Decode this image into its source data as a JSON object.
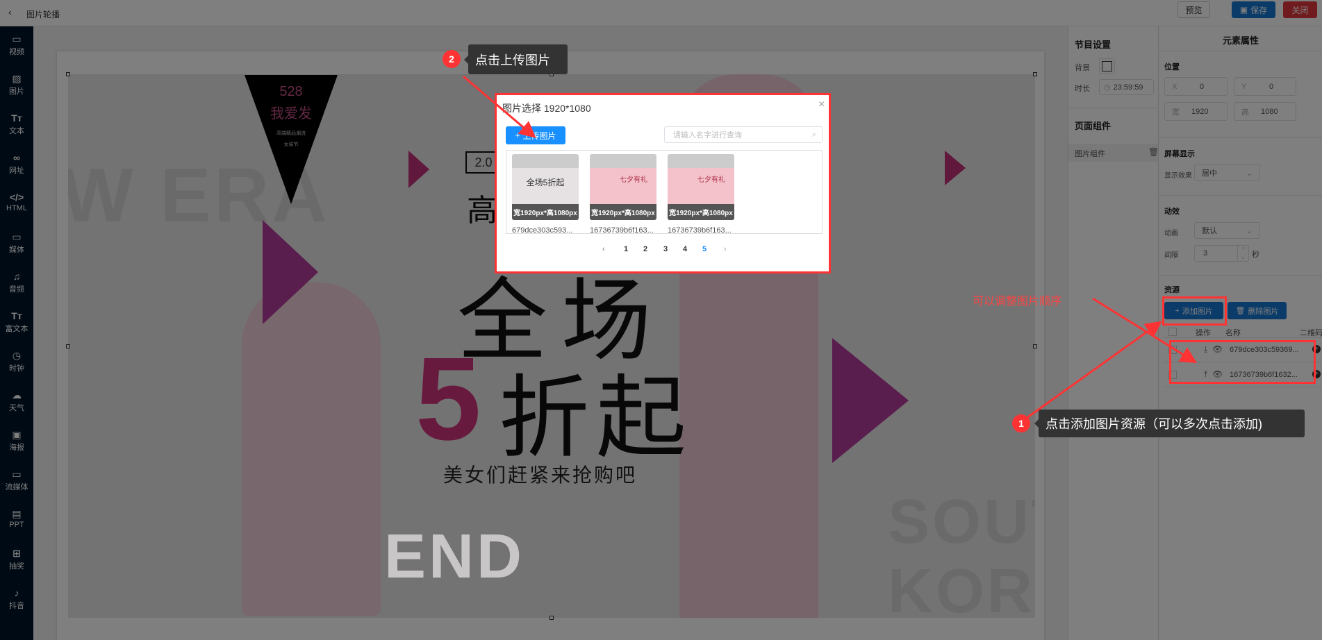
{
  "header": {
    "back_icon": "chevron-left-icon",
    "title": "图片轮播",
    "preview": "预览",
    "save": "保存",
    "close": "关闭",
    "colors": {
      "save": "#1677d2",
      "close": "#e0383e"
    }
  },
  "sidebar": {
    "items": [
      {
        "label": "视频",
        "icon": "video-icon",
        "glyph": "▭"
      },
      {
        "label": "图片",
        "icon": "image-icon",
        "glyph": "▨"
      },
      {
        "label": "文本",
        "icon": "text-icon",
        "glyph": "Tт"
      },
      {
        "label": "网址",
        "icon": "link-icon",
        "glyph": "∞"
      },
      {
        "label": "HTML",
        "icon": "code-icon",
        "glyph": "</>"
      },
      {
        "label": "媒体",
        "icon": "media-icon",
        "glyph": "▭"
      },
      {
        "label": "音频",
        "icon": "music-icon",
        "glyph": "♫"
      },
      {
        "label": "富文本",
        "icon": "rich-text-icon",
        "glyph": "Tт"
      },
      {
        "label": "时钟",
        "icon": "clock-icon",
        "glyph": "◷"
      },
      {
        "label": "天气",
        "icon": "cloud-icon",
        "glyph": "☁"
      },
      {
        "label": "海报",
        "icon": "poster-icon",
        "glyph": "▣"
      },
      {
        "label": "流媒体",
        "icon": "stream-icon",
        "glyph": "▭"
      },
      {
        "label": "PPT",
        "icon": "ppt-icon",
        "glyph": "▤"
      },
      {
        "label": "抽奖",
        "icon": "gift-icon",
        "glyph": "⊞"
      },
      {
        "label": "抖音",
        "icon": "tiktok-icon",
        "glyph": "♪"
      }
    ]
  },
  "banner": {
    "badge_num": "528",
    "badge_title": "我爱发",
    "badge_sub1": "高端精品潮流",
    "badge_sub2": "女装节",
    "tag": "2.0",
    "high": "高",
    "line1": "全场",
    "five": "5",
    "line2": "折起",
    "slogan": "美女们赶紧来抢购吧",
    "bg_words": [
      "W ERA",
      "SOUT",
      "KORE",
      "END"
    ]
  },
  "program": {
    "title": "节目设置",
    "bg_label": "背景",
    "duration_label": "时长",
    "duration": "23:59:59",
    "components_title": "页面组件",
    "component": "图片组件"
  },
  "props": {
    "title": "元素属性",
    "position": "位置",
    "x_label": "X",
    "x": "0",
    "y_label": "Y",
    "y": "0",
    "w_label": "宽",
    "w": "1920",
    "h_label": "高",
    "h": "1080",
    "screen": "屏幕显示",
    "effect_label": "显示效果",
    "effect": "居中",
    "motion": "动效",
    "anim_label": "动画",
    "anim": "默认",
    "interval_label": "间隔",
    "interval": "3",
    "sec": "秒",
    "resources": "资源",
    "add": "添加图片",
    "delete": "删除图片",
    "cols": [
      "操作",
      "名称",
      "二维码"
    ],
    "rows": [
      {
        "name": "679dce303c59369..."
      },
      {
        "name": "16736739b6f1632..."
      }
    ]
  },
  "modal": {
    "title": "图片选择 1920*1080",
    "upload": "上传图片",
    "search_placeholder": "请输入名字进行查询",
    "cards": [
      {
        "size": "宽1920px*高1080px",
        "name": "679dce303c593...",
        "thumb": "全场5折起"
      },
      {
        "size": "宽1920px*高1080px",
        "name": "16736739b6f163...",
        "thumb": "七夕有礼"
      },
      {
        "size": "宽1920px*高1080px",
        "name": "16736739b6f163...",
        "thumb": "七夕有礼"
      }
    ],
    "pages": [
      "1",
      "2",
      "3",
      "4",
      "5"
    ],
    "current_page": "5"
  },
  "annotations": {
    "step1_num": "1",
    "step1": "点击添加图片资源（可以多次点击添加)",
    "step2_num": "2",
    "step2": "点击上传图片",
    "reorder_note": "可以调整图片顺序"
  }
}
